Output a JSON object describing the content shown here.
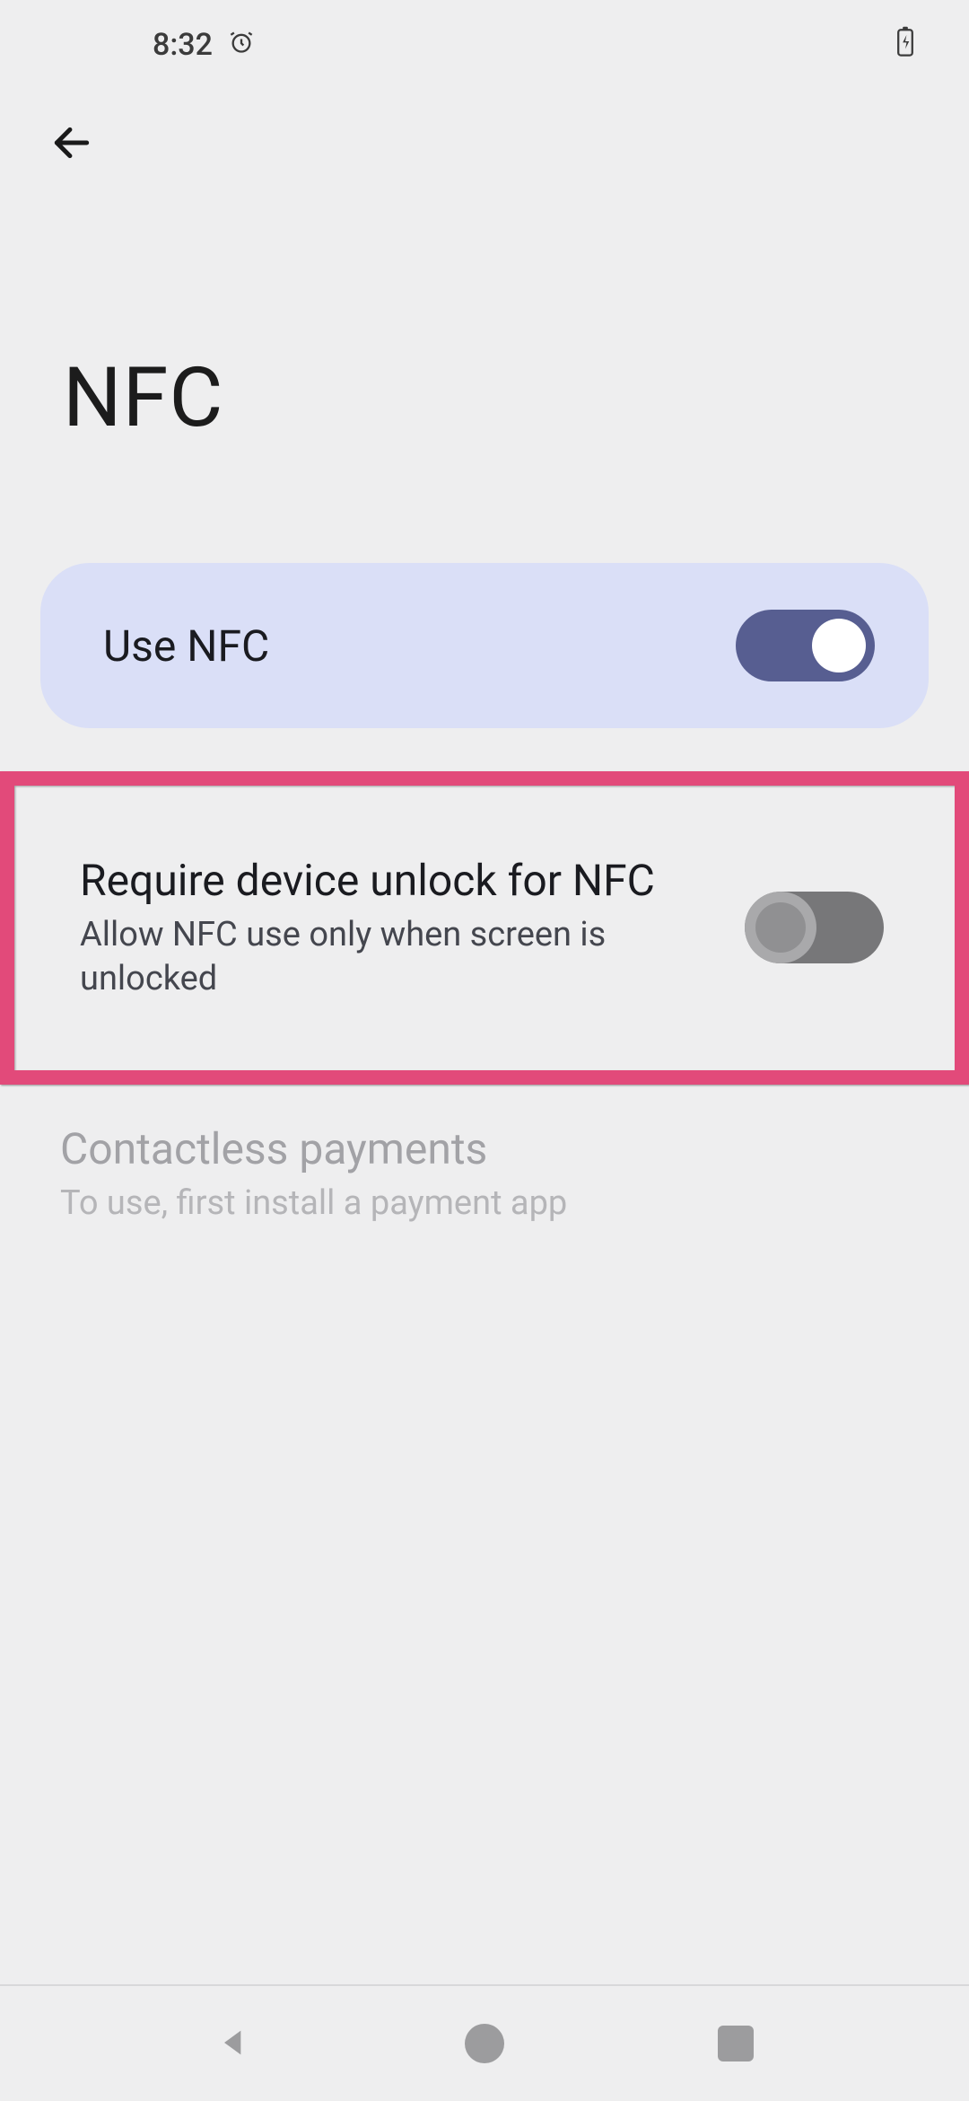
{
  "status": {
    "time": "8:32",
    "icons": {
      "left": "alarm-icon",
      "battery": "battery-charging-icon"
    }
  },
  "header": {
    "back_icon": "arrow-back-icon",
    "title": "NFC"
  },
  "settings": {
    "use_nfc": {
      "label": "Use NFC",
      "enabled": true
    },
    "require_unlock": {
      "title": "Require device unlock for NFC",
      "subtitle": "Allow NFC use only when screen is unlocked",
      "enabled": false,
      "highlighted": true
    },
    "contactless": {
      "title": "Contactless payments",
      "subtitle": "To use, first install a payment app",
      "disabled": true
    }
  },
  "nav": {
    "back": "nav-back-icon",
    "home": "nav-home-icon",
    "recent": "nav-recent-icon"
  },
  "colors": {
    "accent_card": "#dadff7",
    "toggle_on": "#575e91",
    "highlight": "#e24a7a"
  }
}
